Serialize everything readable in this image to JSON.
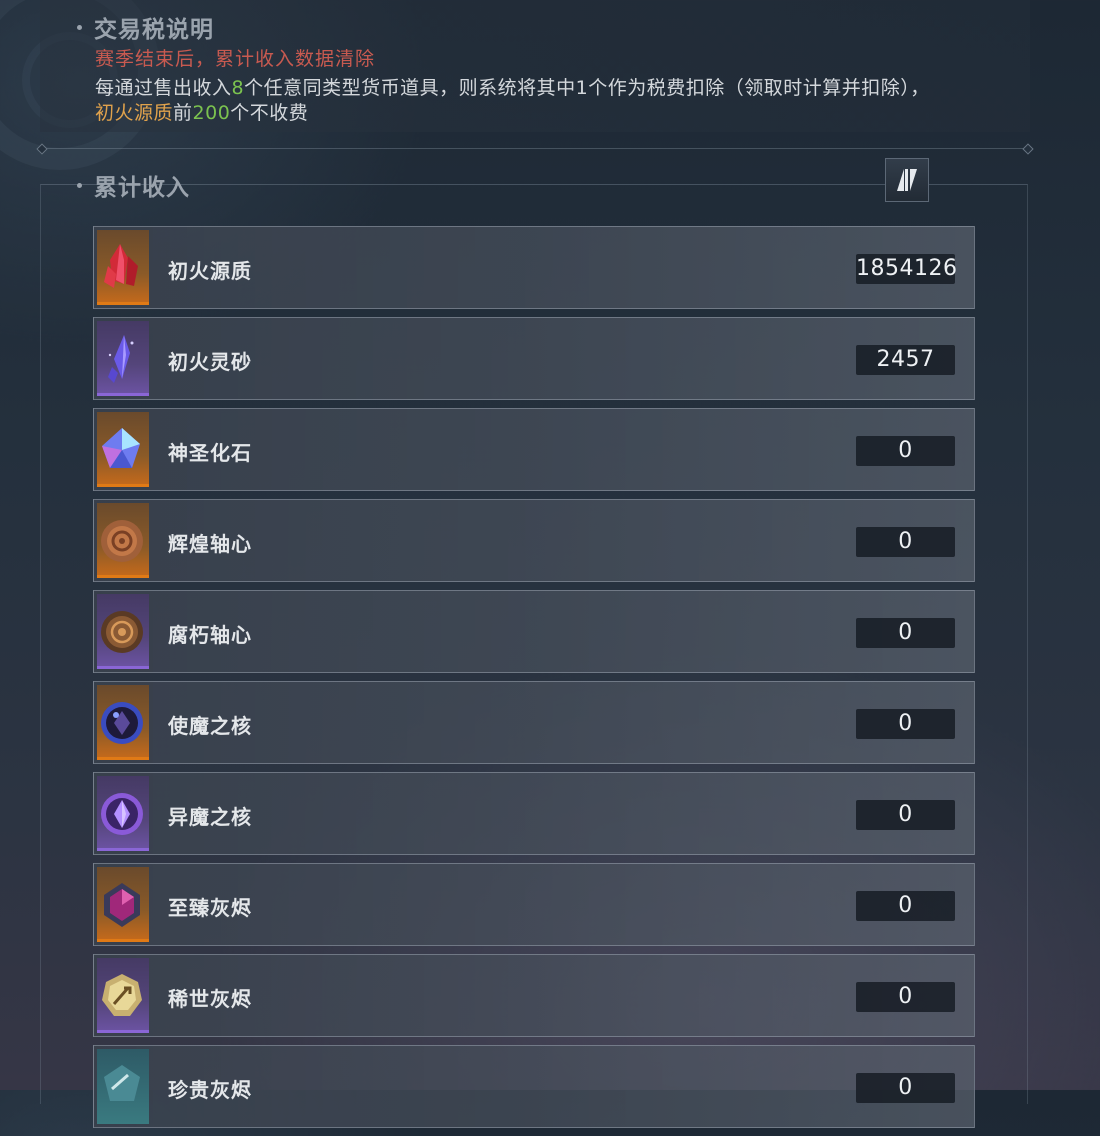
{
  "tax": {
    "title": "交易税说明",
    "season_note": "赛季结束后，累计收入数据清除",
    "desc_part1": "每通过售出收入",
    "desc_num_8": "8",
    "desc_part2": "个任意同类型货币道具，则系统将其中1个作为税费扣除（领取时计算并扣除），",
    "desc_item": "初火源质",
    "desc_part3": "前",
    "desc_num_200": "200",
    "desc_part4": "个不收费"
  },
  "income": {
    "title": "累计收入",
    "sort_icon": "swap-sort-icon"
  },
  "items": [
    {
      "name": "初火源质",
      "value": "1854126",
      "rarity": "orange",
      "icon": "red-crystal-icon"
    },
    {
      "name": "初火灵砂",
      "value": "2457",
      "rarity": "purple",
      "icon": "violet-shard-icon"
    },
    {
      "name": "神圣化石",
      "value": "0",
      "rarity": "orange",
      "icon": "prism-gem-icon"
    },
    {
      "name": "辉煌轴心",
      "value": "0",
      "rarity": "orange",
      "icon": "bronze-gear-icon"
    },
    {
      "name": "腐朽轴心",
      "value": "0",
      "rarity": "purple",
      "icon": "rusted-gear-icon"
    },
    {
      "name": "使魔之核",
      "value": "0",
      "rarity": "orange",
      "icon": "dark-orb-icon"
    },
    {
      "name": "异魔之核",
      "value": "0",
      "rarity": "purple",
      "icon": "purple-orb-icon"
    },
    {
      "name": "至臻灰烬",
      "value": "0",
      "rarity": "orange",
      "icon": "magenta-gem-icon"
    },
    {
      "name": "稀世灰烬",
      "value": "0",
      "rarity": "purple",
      "icon": "gold-seal-icon"
    },
    {
      "name": "珍贵灰烬",
      "value": "0",
      "rarity": "teal",
      "icon": "teal-rune-icon"
    }
  ],
  "colors": {
    "warning": "#c85a50",
    "highlight_green": "#7bc24f",
    "highlight_orange": "#e0a24c",
    "rarity_orange": "#e07a16",
    "rarity_purple": "#8a66d6"
  }
}
